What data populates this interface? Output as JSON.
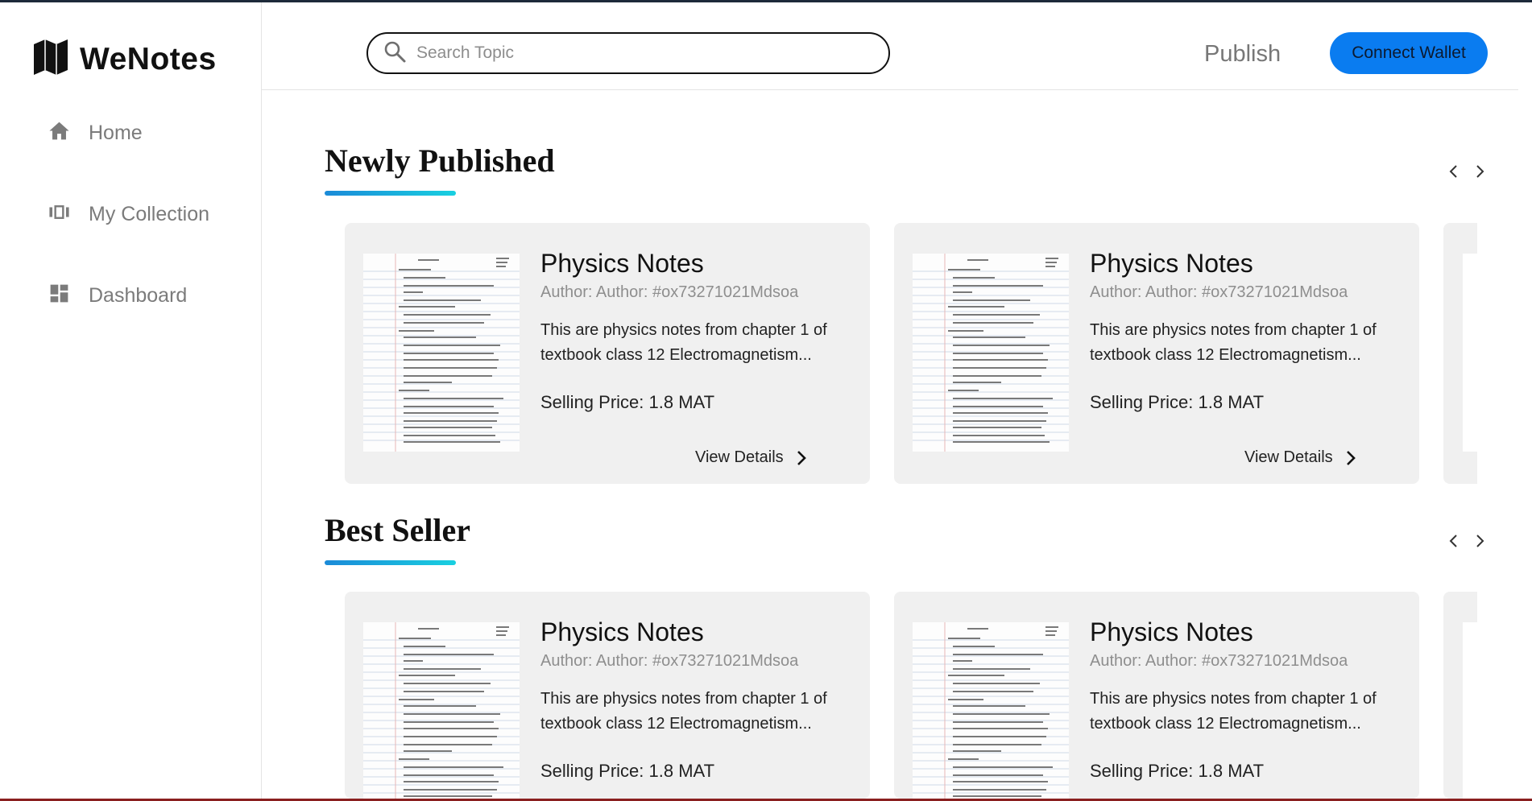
{
  "app": {
    "name": "WeNotes"
  },
  "sidebar": {
    "items": [
      {
        "label": "Home",
        "icon": "home-icon"
      },
      {
        "label": "My Collection",
        "icon": "collection-icon"
      },
      {
        "label": "Dashboard",
        "icon": "dashboard-icon"
      }
    ]
  },
  "header": {
    "search_placeholder": "Search Topic",
    "publish_label": "Publish",
    "connect_label": "Connect Wallet"
  },
  "sections": [
    {
      "title": "Newly Published",
      "cards": [
        {
          "title": "Physics Notes",
          "author": "Author: Author: #ox73271021Mdsoa",
          "description": "This are physics notes from chapter 1 of textbook class 12 Electromagnetism...",
          "price": "Selling Price: 1.8 MAT",
          "action": "View Details"
        },
        {
          "title": "Physics Notes",
          "author": "Author: Author: #ox73271021Mdsoa",
          "description": "This are physics notes from chapter 1 of textbook class 12 Electromagnetism...",
          "price": "Selling Price: 1.8 MAT",
          "action": "View Details"
        }
      ]
    },
    {
      "title": "Best Seller",
      "cards": [
        {
          "title": "Physics Notes",
          "author": "Author: Author: #ox73271021Mdsoa",
          "description": "This are physics notes from chapter 1 of textbook class 12 Electromagnetism...",
          "price": "Selling Price: 1.8 MAT"
        },
        {
          "title": "Physics Notes",
          "author": "Author: Author: #ox73271021Mdsoa",
          "description": "This are physics notes from chapter 1 of textbook class 12 Electromagnetism...",
          "price": "Selling Price: 1.8 MAT"
        }
      ]
    }
  ],
  "colors": {
    "accent": "#0a7cf0",
    "underline_start": "#1b8ad8",
    "underline_end": "#19d0e0",
    "card_bg": "#f0f0f0"
  }
}
